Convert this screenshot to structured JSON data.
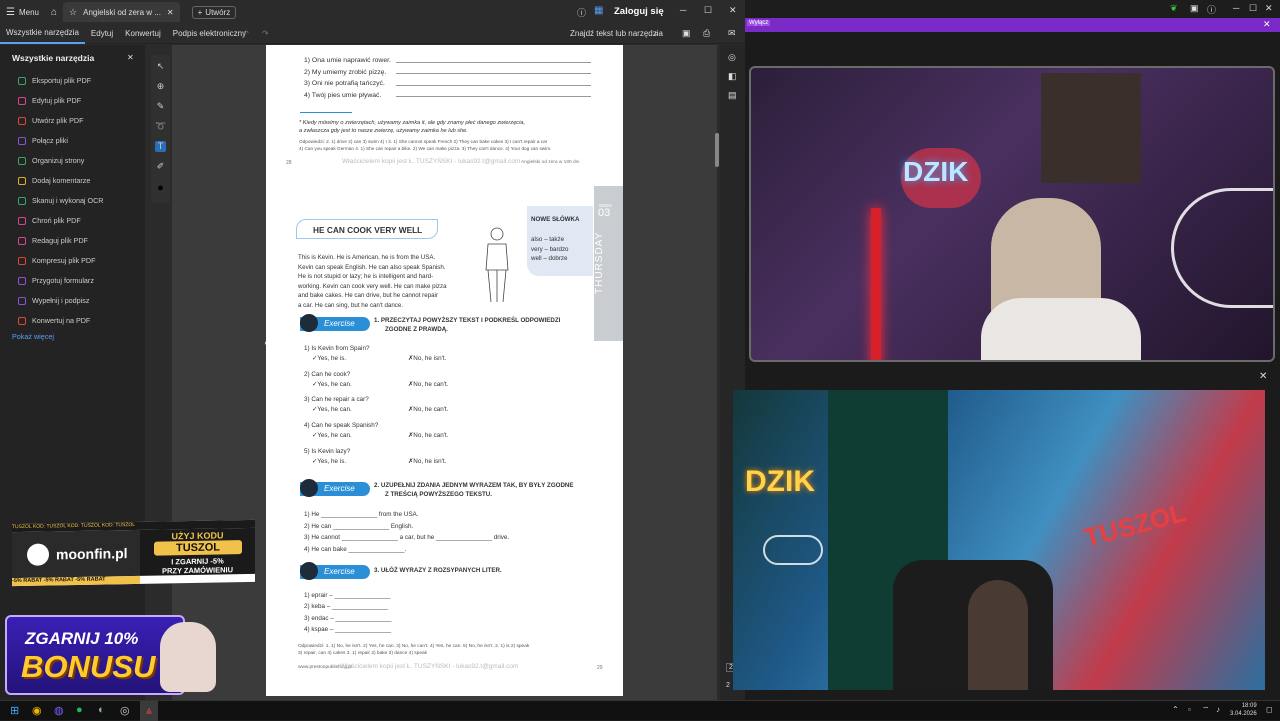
{
  "acrobat": {
    "menu_label": "Menu",
    "tab_title": "Angielski od zera w ...",
    "new_button": "Utwórz",
    "login": "Zaloguj się",
    "menubar": [
      "Wszystkie narzędzia",
      "Edytuj",
      "Konwertuj",
      "Podpis elektroniczny"
    ],
    "find_tools": "Znajdź tekst lub narzędzia",
    "panel_title": "Wszystkie narzędzia",
    "tools": [
      {
        "label": "Eksportuj plik PDF",
        "color": "#3aa76d"
      },
      {
        "label": "Edytuj plik PDF",
        "color": "#d9468f"
      },
      {
        "label": "Utwórz plik PDF",
        "color": "#e0463a"
      },
      {
        "label": "Połącz pliki",
        "color": "#8e53d4"
      },
      {
        "label": "Organizuj strony",
        "color": "#3aa76d"
      },
      {
        "label": "Dodaj komentarze",
        "color": "#e5b020"
      },
      {
        "label": "Skanuj i wykonaj OCR",
        "color": "#3aa76d"
      },
      {
        "label": "Chroń plik PDF",
        "color": "#d9468f"
      },
      {
        "label": "Redaguj plik PDF",
        "color": "#d9468f"
      },
      {
        "label": "Kompresuj plik PDF",
        "color": "#e0463a"
      },
      {
        "label": "Przygotuj formularz",
        "color": "#8e53d4"
      },
      {
        "label": "Wypełnij i podpisz",
        "color": "#8e53d4"
      },
      {
        "label": "Konwertuj na PDF",
        "color": "#e0463a"
      }
    ],
    "show_less": "Pokaż więcej"
  },
  "page1": {
    "items": [
      "1)  Ona umie naprawić rower.",
      "2)  My umiemy zrobić pizzę.",
      "3)  Oni nie potrafią tańczyć.",
      "4)  Twój pies umie pływać."
    ],
    "note1": "*  Kiedy mówimy o zwierzętach, używamy zaimka it, ale gdy znamy płeć danego zwierzęcia,",
    "note2": "a zwłaszcza gdy jest to nasze zwierzę, używamy zaimka he lub she.",
    "answers1": "Odpowiedzi: 2. 1) drive 2) can 3) swim 4) I  3. 1) She cannot speak French 2) They can bake cakes 3) I can't repair a car",
    "answers2": "4) Can you speak German 4. 1) She can repair a bike. 2) We can make pizza. 3) They can't dance. 4) Your dog can swim.",
    "page_num": "28",
    "watermark": "Właścicielem kopii jest Ł. TUSZYŃSKI - lukas92.t@gmail.com",
    "footer_right": "Angielski od zera w 180 dni"
  },
  "page2": {
    "heading": "HE CAN COOK VERY WELL",
    "new_words_title": "NOWE SŁÓWKA",
    "new_words": [
      "also – także",
      "very – bardzo",
      "well – dobrze"
    ],
    "week_label": "WEEK",
    "week_num": "03",
    "day": "THURSDAY",
    "story": [
      "This is Kevin. He is American, he is from the USA.",
      "Kevin can speak English. He can also speak Spanish.",
      "He is not stupid or lazy; he is intelligent and hard-",
      "working. Kevin can cook very well. He can make pizza",
      "and bake cakes. He can drive, but he cannot repair",
      "a car. He can sing, but he can't dance."
    ],
    "exercise_label": "Exercise",
    "ex1_title": "1.  PRZECZYTAJ POWYŻSZY TEKST I PODKREŚL ODPOWIEDZI",
    "ex1_title2": "ZGODNE Z PRAWDĄ.",
    "ex1": [
      {
        "q": "1)  Is Kevin from Spain?",
        "a": "✓Yes, he is.",
        "b": "✗No, he isn't."
      },
      {
        "q": "2)  Can he cook?",
        "a": "✓Yes, he can.",
        "b": "✗No, he can't."
      },
      {
        "q": "3)  Can he repair a car?",
        "a": "✓Yes, he can.",
        "b": "✗No, he can't."
      },
      {
        "q": "4)  Can he speak Spanish?",
        "a": "✓Yes, he can.",
        "b": "✗No, he can't."
      },
      {
        "q": "5)  Is Kevin lazy?",
        "a": "✓Yes, he is.",
        "b": "✗No, he isn't."
      }
    ],
    "ex2_title": "2.  UZUPEŁNIJ ZDANIA JEDNYM WYRAZEM TAK, BY BYŁY ZGODNE",
    "ex2_title2": "Z TREŚCIĄ POWYŻSZEGO TEKSTU.",
    "ex2": [
      "1)  He ________________ from the USA.",
      "2)  He can ________________ English.",
      "3)  He cannot ________________ a car, but he ________________ drive.",
      "4)  He can bake ________________."
    ],
    "ex3_title": "3.  UŁÓŻ WYRAZY Z ROZSYPANYCH LITER.",
    "ex3": [
      "1)  eprair – ________________",
      "2)  keba – ________________",
      "3)  endac – ________________",
      "4)  kspae – ________________"
    ],
    "answers": "Odpowiedzi: 1. 1) No, he isn't. 2) Yes, he can. 3) No, he can't. 4) Yes, he can. 5) No, he isn't.  2. 1) is 2) speak",
    "answers2": "3) repair, can 4) cakes  3. 1) repair 2) bake 3) dance 4) speak",
    "site": "www.prestonpublishing.pl",
    "watermark": "Właścicielem kopii jest Ł. TUSZYŃSKI - lukas92.t@gmail.com",
    "page_num": "29"
  },
  "promo": {
    "ticker": "TUSZOL KOD: TUSZOL KOD: TUSZOL KOD: TUSZOL",
    "brand": "moonfin.pl",
    "use_code": "UŻYJ KODU",
    "code": "TUSZOL",
    "discount": "I ZGARNIJ -5%",
    "on_order": "PRZY ZAMÓWIENIU",
    "ticker2": "-5% RABAT -5% RABAT -5% RABAT",
    "bonus_top": "ZGARNIJ 10%",
    "bonus_main": "BONUSU"
  },
  "overlay": {
    "disable": "Wyłącz",
    "neon1": "DZIK",
    "neon2": "DZIK",
    "graffiti": "TUSZOL",
    "side_badge1": "2",
    "side_badge2": "2"
  },
  "taskbar": {
    "time": "18:09",
    "date": "3.04.2026"
  },
  "colors": {
    "accent": "#5a9ef5",
    "exercise_blue": "#2a8fd6",
    "purple": "#7a2bc7"
  }
}
